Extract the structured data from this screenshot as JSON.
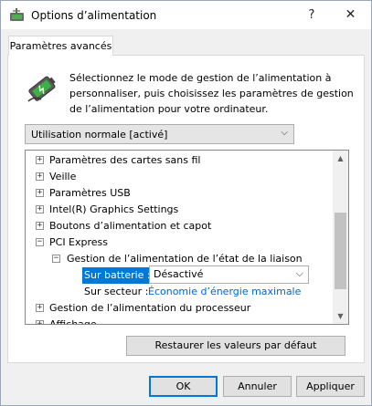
{
  "window": {
    "title": "Options d’alimentation",
    "help_glyph": "?",
    "close_glyph": "✕"
  },
  "tab": {
    "label": "Paramètres avancés"
  },
  "description": "Sélectionnez le mode de gestion de l’alimentation à personnaliser, puis choisissez les paramètres de gestion de l’alimentation pour votre ordinateur.",
  "plan_select": {
    "value": "Utilisation normale [activé]",
    "arrow": "⌵"
  },
  "tree": {
    "items": [
      {
        "expander": "+",
        "label": "Paramètres des cartes sans fil"
      },
      {
        "expander": "+",
        "label": "Veille"
      },
      {
        "expander": "+",
        "label": "Paramètres USB"
      },
      {
        "expander": "+",
        "label": "Intel(R) Graphics Settings"
      },
      {
        "expander": "+",
        "label": "Boutons d’alimentation et capot"
      },
      {
        "expander": "−",
        "label": "PCI Express"
      },
      {
        "expander": "−",
        "label": "Gestion de l’alimentation de l’état de la liaison"
      },
      {
        "label": "Sur batterie :",
        "value": "Désactivé"
      },
      {
        "label": "Sur secteur :",
        "value": "Économie d’énergie maximale"
      },
      {
        "expander": "+",
        "label": "Gestion de l’alimentation du processeur"
      },
      {
        "expander": "+",
        "label": "Affichage"
      }
    ],
    "dropdown_arrow": "⌵",
    "scroll_up": "▲",
    "scroll_down": "▼"
  },
  "buttons": {
    "restore": "Restaurer les valeurs par défaut",
    "ok": "OK",
    "cancel": "Annuler",
    "apply": "Appliquer"
  },
  "colors": {
    "selection": "#0078d7",
    "link": "#0066cc",
    "battery_green": "#3cb043"
  },
  "icons": {
    "app": "power-options-icon",
    "panel": "battery-power-icon"
  }
}
